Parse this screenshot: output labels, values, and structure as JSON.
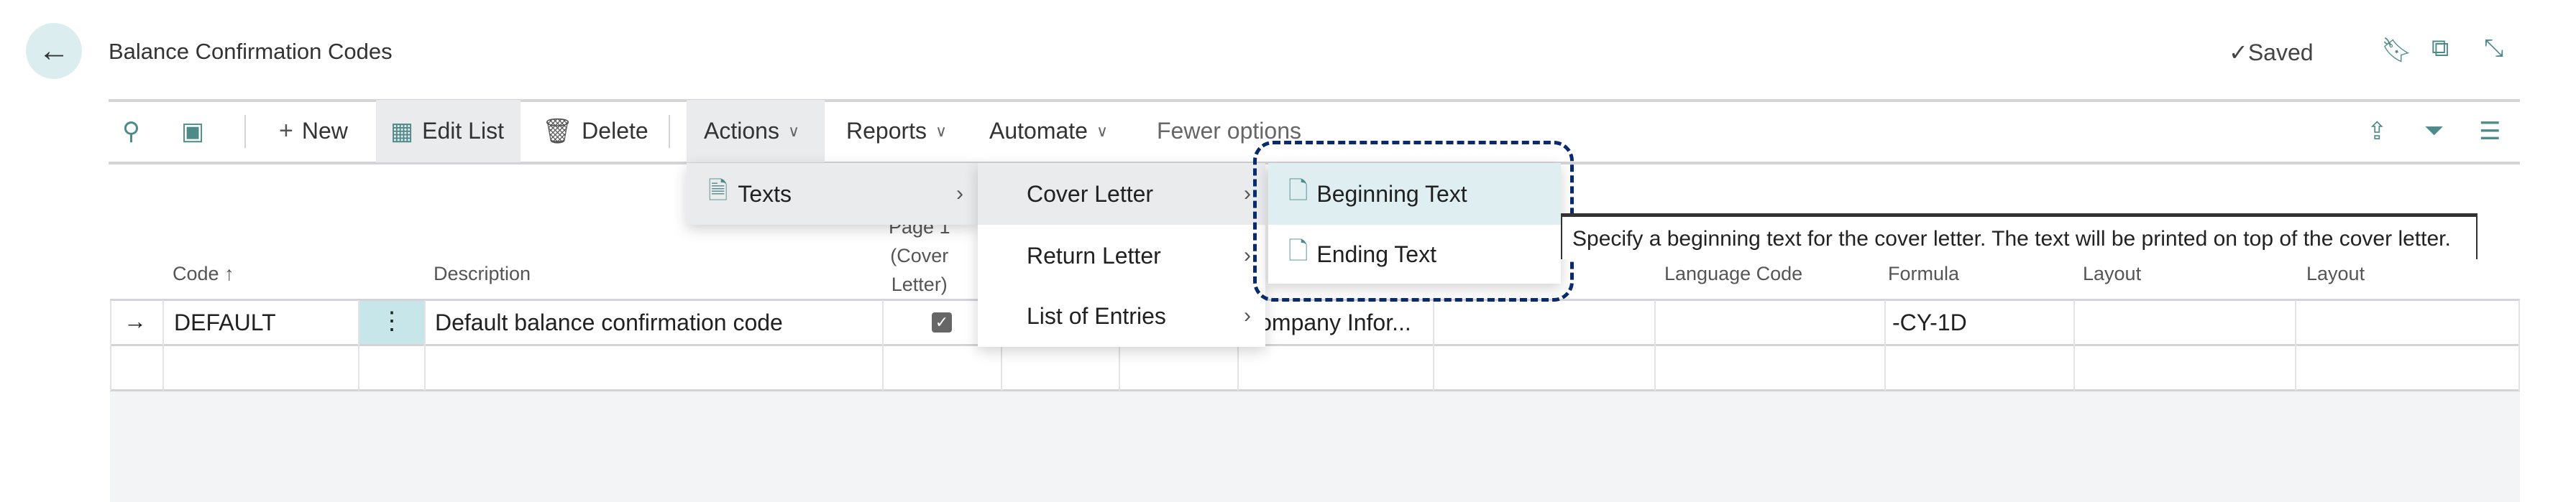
{
  "header": {
    "title": "Balance Confirmation Codes",
    "status": "Saved",
    "back_icon": "arrow-left-icon"
  },
  "toolbar": {
    "new": "New",
    "edit_list": "Edit List",
    "delete": "Delete",
    "actions": "Actions",
    "reports": "Reports",
    "automate": "Automate",
    "fewer_options": "Fewer options"
  },
  "menus": {
    "actions": [
      {
        "label": "Texts"
      }
    ],
    "texts": [
      {
        "label": "Cover Letter"
      },
      {
        "label": "Return Letter"
      },
      {
        "label": "List of Entries"
      }
    ],
    "cover_letter": [
      {
        "label": "Beginning Text"
      },
      {
        "label": "Ending Text"
      }
    ]
  },
  "tooltip": "Specify a beginning text for the cover letter. The text will be printed on top of the cover letter.",
  "table": {
    "columns": {
      "code": "Code",
      "description": "Description",
      "page1_l1": "Page 1",
      "page1_l2": "(Cover",
      "page1_l3": "Letter)",
      "language_code": "Language Code",
      "formula": "Formula",
      "layout1": "Layout",
      "layout2": "Layout"
    },
    "rows": [
      {
        "code": "DEFAULT",
        "description": "Default balance confirmation code",
        "page1_cover_letter": true,
        "company": "Company Infor...",
        "formula": "-CY-1D"
      }
    ]
  },
  "colors": {
    "accent": "#4f8a8b",
    "focus": "#0a2a6b",
    "selected_cell": "#c7e6ea",
    "menu_highlight": "#dfeef1"
  }
}
